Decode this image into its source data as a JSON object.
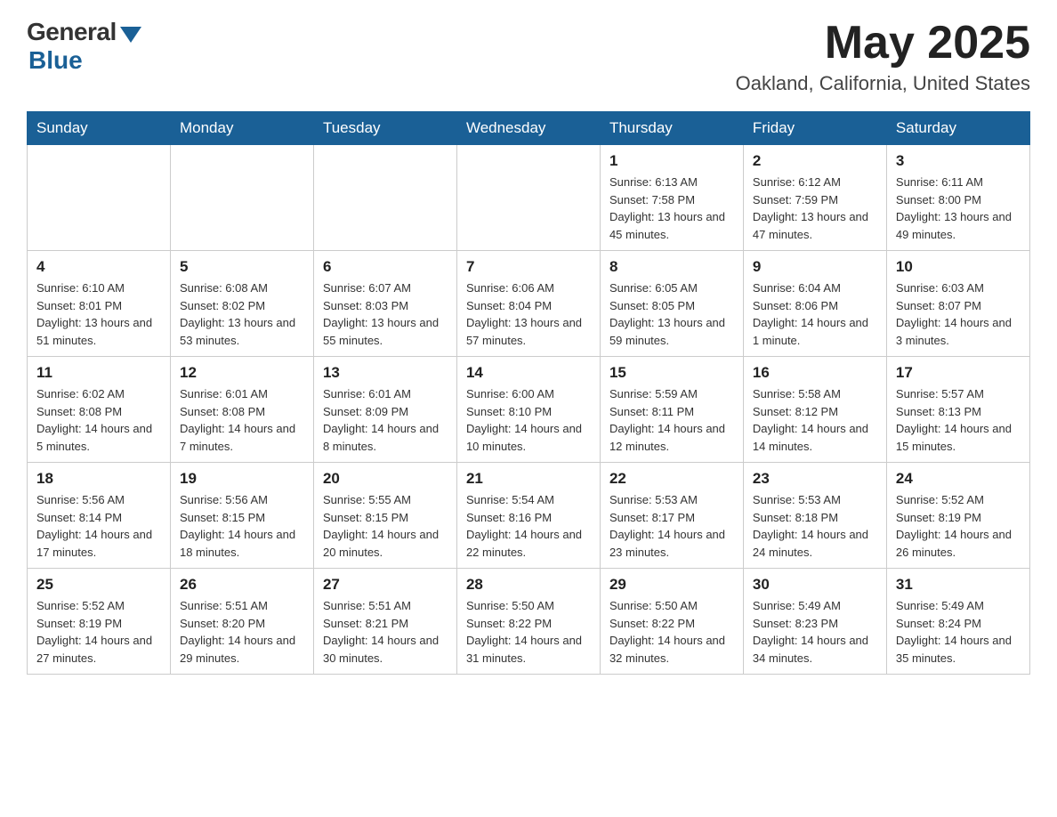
{
  "logo": {
    "general_text": "General",
    "blue_text": "Blue"
  },
  "header": {
    "month_year": "May 2025",
    "location": "Oakland, California, United States"
  },
  "weekdays": [
    "Sunday",
    "Monday",
    "Tuesday",
    "Wednesday",
    "Thursday",
    "Friday",
    "Saturday"
  ],
  "weeks": [
    [
      {
        "day": "",
        "info": ""
      },
      {
        "day": "",
        "info": ""
      },
      {
        "day": "",
        "info": ""
      },
      {
        "day": "",
        "info": ""
      },
      {
        "day": "1",
        "info": "Sunrise: 6:13 AM\nSunset: 7:58 PM\nDaylight: 13 hours and 45 minutes."
      },
      {
        "day": "2",
        "info": "Sunrise: 6:12 AM\nSunset: 7:59 PM\nDaylight: 13 hours and 47 minutes."
      },
      {
        "day": "3",
        "info": "Sunrise: 6:11 AM\nSunset: 8:00 PM\nDaylight: 13 hours and 49 minutes."
      }
    ],
    [
      {
        "day": "4",
        "info": "Sunrise: 6:10 AM\nSunset: 8:01 PM\nDaylight: 13 hours and 51 minutes."
      },
      {
        "day": "5",
        "info": "Sunrise: 6:08 AM\nSunset: 8:02 PM\nDaylight: 13 hours and 53 minutes."
      },
      {
        "day": "6",
        "info": "Sunrise: 6:07 AM\nSunset: 8:03 PM\nDaylight: 13 hours and 55 minutes."
      },
      {
        "day": "7",
        "info": "Sunrise: 6:06 AM\nSunset: 8:04 PM\nDaylight: 13 hours and 57 minutes."
      },
      {
        "day": "8",
        "info": "Sunrise: 6:05 AM\nSunset: 8:05 PM\nDaylight: 13 hours and 59 minutes."
      },
      {
        "day": "9",
        "info": "Sunrise: 6:04 AM\nSunset: 8:06 PM\nDaylight: 14 hours and 1 minute."
      },
      {
        "day": "10",
        "info": "Sunrise: 6:03 AM\nSunset: 8:07 PM\nDaylight: 14 hours and 3 minutes."
      }
    ],
    [
      {
        "day": "11",
        "info": "Sunrise: 6:02 AM\nSunset: 8:08 PM\nDaylight: 14 hours and 5 minutes."
      },
      {
        "day": "12",
        "info": "Sunrise: 6:01 AM\nSunset: 8:08 PM\nDaylight: 14 hours and 7 minutes."
      },
      {
        "day": "13",
        "info": "Sunrise: 6:01 AM\nSunset: 8:09 PM\nDaylight: 14 hours and 8 minutes."
      },
      {
        "day": "14",
        "info": "Sunrise: 6:00 AM\nSunset: 8:10 PM\nDaylight: 14 hours and 10 minutes."
      },
      {
        "day": "15",
        "info": "Sunrise: 5:59 AM\nSunset: 8:11 PM\nDaylight: 14 hours and 12 minutes."
      },
      {
        "day": "16",
        "info": "Sunrise: 5:58 AM\nSunset: 8:12 PM\nDaylight: 14 hours and 14 minutes."
      },
      {
        "day": "17",
        "info": "Sunrise: 5:57 AM\nSunset: 8:13 PM\nDaylight: 14 hours and 15 minutes."
      }
    ],
    [
      {
        "day": "18",
        "info": "Sunrise: 5:56 AM\nSunset: 8:14 PM\nDaylight: 14 hours and 17 minutes."
      },
      {
        "day": "19",
        "info": "Sunrise: 5:56 AM\nSunset: 8:15 PM\nDaylight: 14 hours and 18 minutes."
      },
      {
        "day": "20",
        "info": "Sunrise: 5:55 AM\nSunset: 8:15 PM\nDaylight: 14 hours and 20 minutes."
      },
      {
        "day": "21",
        "info": "Sunrise: 5:54 AM\nSunset: 8:16 PM\nDaylight: 14 hours and 22 minutes."
      },
      {
        "day": "22",
        "info": "Sunrise: 5:53 AM\nSunset: 8:17 PM\nDaylight: 14 hours and 23 minutes."
      },
      {
        "day": "23",
        "info": "Sunrise: 5:53 AM\nSunset: 8:18 PM\nDaylight: 14 hours and 24 minutes."
      },
      {
        "day": "24",
        "info": "Sunrise: 5:52 AM\nSunset: 8:19 PM\nDaylight: 14 hours and 26 minutes."
      }
    ],
    [
      {
        "day": "25",
        "info": "Sunrise: 5:52 AM\nSunset: 8:19 PM\nDaylight: 14 hours and 27 minutes."
      },
      {
        "day": "26",
        "info": "Sunrise: 5:51 AM\nSunset: 8:20 PM\nDaylight: 14 hours and 29 minutes."
      },
      {
        "day": "27",
        "info": "Sunrise: 5:51 AM\nSunset: 8:21 PM\nDaylight: 14 hours and 30 minutes."
      },
      {
        "day": "28",
        "info": "Sunrise: 5:50 AM\nSunset: 8:22 PM\nDaylight: 14 hours and 31 minutes."
      },
      {
        "day": "29",
        "info": "Sunrise: 5:50 AM\nSunset: 8:22 PM\nDaylight: 14 hours and 32 minutes."
      },
      {
        "day": "30",
        "info": "Sunrise: 5:49 AM\nSunset: 8:23 PM\nDaylight: 14 hours and 34 minutes."
      },
      {
        "day": "31",
        "info": "Sunrise: 5:49 AM\nSunset: 8:24 PM\nDaylight: 14 hours and 35 minutes."
      }
    ]
  ]
}
